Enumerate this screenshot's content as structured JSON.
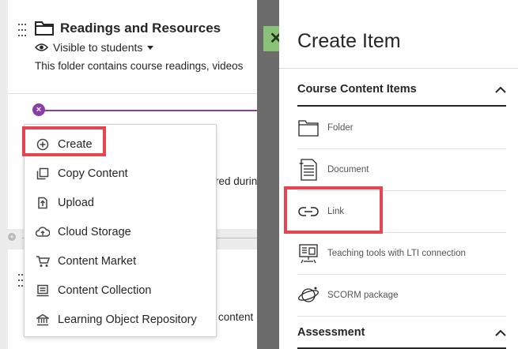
{
  "folder": {
    "title": "Readings and Resources",
    "visibility": "Visible to students",
    "description": "This folder contains course readings, videos"
  },
  "behind_text": {
    "fragment1": "red durin",
    "fragment2": "content"
  },
  "create_menu": {
    "items": [
      {
        "label": "Create",
        "icon": "plus-circle-icon"
      },
      {
        "label": "Copy Content",
        "icon": "copy-icon"
      },
      {
        "label": "Upload",
        "icon": "upload-icon"
      },
      {
        "label": "Cloud Storage",
        "icon": "cloud-upload-icon"
      },
      {
        "label": "Content Market",
        "icon": "cart-icon"
      },
      {
        "label": "Content Collection",
        "icon": "collection-icon"
      },
      {
        "label": "Learning Object Repository",
        "icon": "repository-icon"
      }
    ]
  },
  "close_button": {
    "label": "✕"
  },
  "panel": {
    "title": "Create Item",
    "sections": [
      {
        "label": "Course Content Items",
        "items": [
          {
            "label": "Folder",
            "icon": "folder-icon"
          },
          {
            "label": "Document",
            "icon": "document-icon"
          },
          {
            "label": "Link",
            "icon": "link-icon"
          },
          {
            "label": "Teaching tools with LTI connection",
            "icon": "lti-tool-icon"
          },
          {
            "label": "SCORM package",
            "icon": "scorm-icon"
          }
        ]
      },
      {
        "label": "Assessment",
        "items": []
      }
    ]
  },
  "colors": {
    "highlight": "#e5454e",
    "accent_purple": "#8b3ca9",
    "close_green": "#8bc27a"
  }
}
